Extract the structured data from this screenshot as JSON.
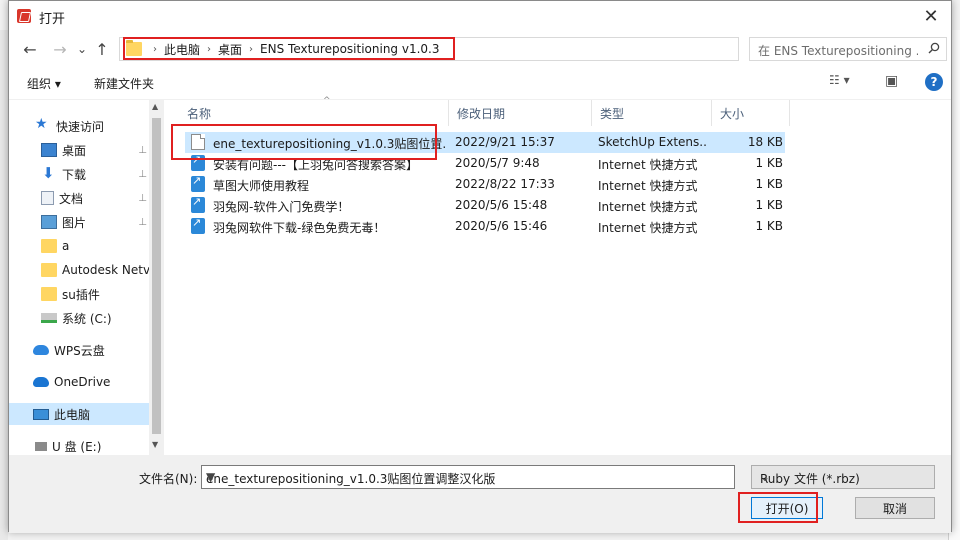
{
  "window": {
    "title": "打开",
    "close_glyph": "✕"
  },
  "nav": {
    "back_glyph": "←",
    "forward_glyph": "→",
    "recent_glyph": "⌄",
    "up_glyph": "↑",
    "breadcrumb_sep": "›",
    "breadcrumbs": [
      "此电脑",
      "桌面",
      "ENS Texturepositioning v1.0.3"
    ],
    "search_placeholder": "在 ENS Texturepositioning ...",
    "dropdown_glyph": "⌄",
    "refresh_glyph": "↻"
  },
  "toolbar": {
    "organize_label": "组织 ▾",
    "new_folder_label": "新建文件夹",
    "view_glyph": "☷ ▾",
    "preview_glyph": "▣",
    "help_glyph": "?"
  },
  "sidebar": {
    "items": [
      {
        "label": "快速访问",
        "icon": "star-icon"
      },
      {
        "label": "桌面",
        "icon": "desktop-icon",
        "pinned": true
      },
      {
        "label": "下载",
        "icon": "download-icon",
        "pinned": true
      },
      {
        "label": "文档",
        "icon": "document-icon",
        "pinned": true
      },
      {
        "label": "图片",
        "icon": "pictures-icon",
        "pinned": true
      },
      {
        "label": "a",
        "icon": "folder-icon"
      },
      {
        "label": "Autodesk Netv",
        "icon": "folder-icon"
      },
      {
        "label": "su插件",
        "icon": "folder-icon"
      },
      {
        "label": "系统 (C:)",
        "icon": "drive-icon"
      },
      {
        "label": "WPS云盘",
        "icon": "cloud-icon"
      },
      {
        "label": "OneDrive",
        "icon": "onedrive-icon"
      },
      {
        "label": "此电脑",
        "icon": "computer-icon"
      },
      {
        "label": "U 盘 (E:)",
        "icon": "usb-drive-icon"
      }
    ],
    "pin_glyph": "📌"
  },
  "files": {
    "headers": {
      "name": "名称",
      "date": "修改日期",
      "type": "类型",
      "size": "大小",
      "sort_glyph": "^"
    },
    "rows": [
      {
        "name": "ene_texturepositioning_v1.0.3贴图位置...",
        "date": "2022/9/21 15:37",
        "type": "SketchUp Extens...",
        "size": "18 KB",
        "icon": "file-icon"
      },
      {
        "name": "安装有问题---【上羽兔问答搜索答案】",
        "date": "2020/5/7 9:48",
        "type": "Internet 快捷方式",
        "size": "1 KB",
        "icon": "shortcut-icon"
      },
      {
        "name": "草图大师使用教程",
        "date": "2022/8/22 17:33",
        "type": "Internet 快捷方式",
        "size": "1 KB",
        "icon": "shortcut-icon"
      },
      {
        "name": "羽兔网-软件入门免费学！",
        "date": "2020/5/6 15:48",
        "type": "Internet 快捷方式",
        "size": "1 KB",
        "icon": "shortcut-icon"
      },
      {
        "name": "羽兔网软件下载-绿色免费无毒！",
        "date": "2020/5/6 15:46",
        "type": "Internet 快捷方式",
        "size": "1 KB",
        "icon": "shortcut-icon"
      }
    ]
  },
  "footer": {
    "filename_label": "文件名(N):",
    "filename_value": "ene_texturepositioning_v1.0.3贴图位置调整汉化版",
    "filetype_value": "Ruby 文件 (*.rbz)",
    "open_label": "打开(O)",
    "cancel_label": "取消"
  },
  "colors": {
    "highlight": "#e02020",
    "selection": "#cce8ff",
    "accent": "#0078d7"
  }
}
